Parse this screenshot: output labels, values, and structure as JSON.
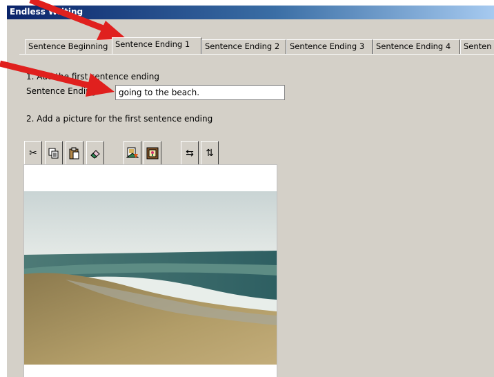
{
  "window": {
    "title": "Endless Writing"
  },
  "tabs": [
    {
      "label": "Sentence Beginning"
    },
    {
      "label": "Sentence Ending 1"
    },
    {
      "label": "Sentence Ending 2"
    },
    {
      "label": "Sentence Ending 3"
    },
    {
      "label": "Sentence Ending 4"
    },
    {
      "label": "Senten"
    }
  ],
  "active_tab": "Sentence Ending 1",
  "step1": {
    "heading": "1. Add the first sentence ending",
    "field_label": "Sentence Ending",
    "field_value": "going to the beach."
  },
  "step2": {
    "heading": "2. Add a picture for the first sentence ending"
  },
  "toolbar": [
    "cut-icon",
    "copy-icon",
    "paste-icon",
    "eraser-icon",
    "open-image-icon",
    "picture-frame-icon",
    "flip-horizontal-icon",
    "flip-vertical-icon"
  ],
  "picture": {
    "subject": "beach photo"
  },
  "colors": {
    "arrow": "#e0201e",
    "title_bar": "#0a246a",
    "window_bg": "#d4d0c8"
  }
}
